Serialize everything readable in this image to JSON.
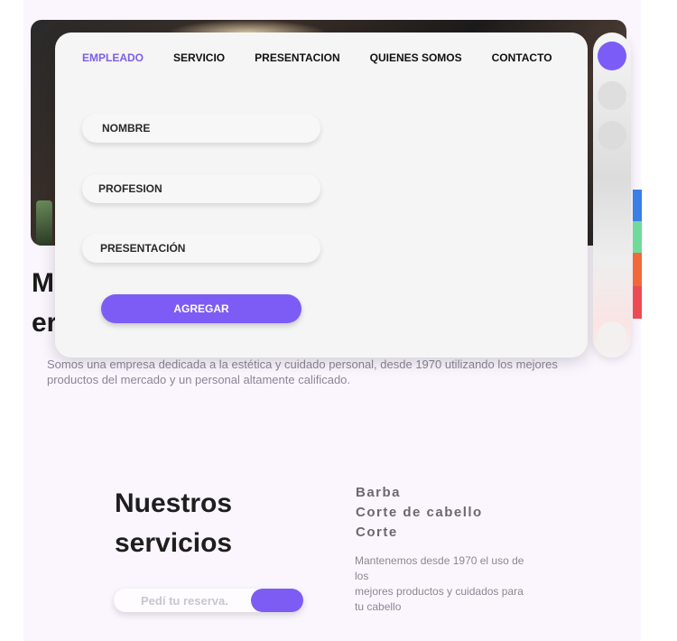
{
  "page": {
    "headline": "M\ner",
    "intro": "Somos una empresa dedicada a la estética y cuidado personal, desde 1970 utilizando los mejores productos del mercado y un personal altamente calificado."
  },
  "modal": {
    "tabs": [
      {
        "label": "EMPLEADO",
        "active": true
      },
      {
        "label": "SERVICIO"
      },
      {
        "label": "PRESENTACION"
      },
      {
        "label": "QUIENES SOMOS"
      },
      {
        "label": "CONTACTO"
      }
    ],
    "fields": [
      {
        "label": "NOMBRE"
      },
      {
        "label": "PROFESION"
      },
      {
        "label": "PRESENTACIÓN"
      }
    ],
    "add_label": "AGREGAR"
  },
  "rail": {
    "dots": [
      {
        "color": "#7b5cf6"
      },
      {
        "color": "#dedede"
      },
      {
        "color": "#dcdcdc"
      },
      {
        "color": "#f3f0f0"
      }
    ],
    "stripes": [
      {
        "color": "#3a7ee8"
      },
      {
        "color": "#6fdb9a"
      },
      {
        "color": "#f2683a"
      },
      {
        "color": "#ee4a55"
      }
    ]
  },
  "services": {
    "title": "Nuestros servicios",
    "items": [
      "Barba",
      "Corte de cabello",
      "Corte"
    ],
    "description": "Mantenemos desde 1970 el uso de los\nmejores productos y cuidados para tu cabello",
    "reserve_placeholder": "Pedí tu reserva."
  }
}
